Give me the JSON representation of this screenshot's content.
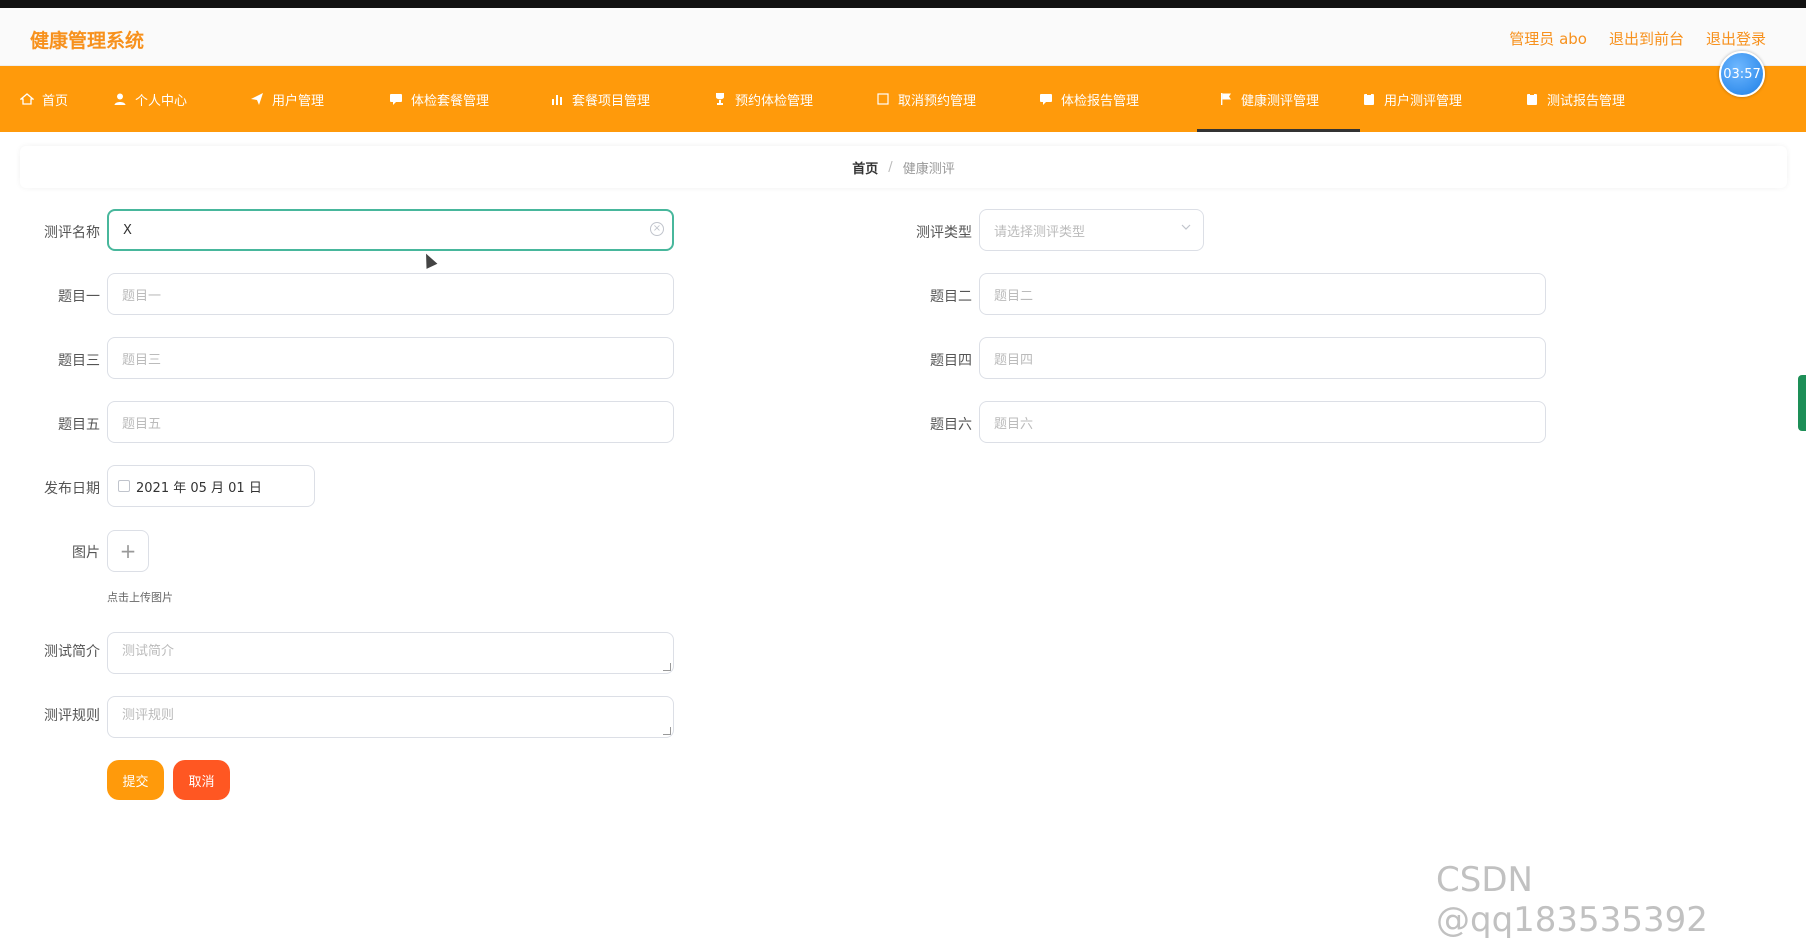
{
  "header": {
    "brand": "健康管理系统",
    "links": [
      "管理员 abo",
      "退出到前台",
      "退出登录"
    ]
  },
  "timer": "03:57",
  "nav": {
    "items": [
      {
        "label": "首页",
        "icon": "home-icon",
        "active": false
      },
      {
        "label": "个人中心",
        "icon": "user-icon",
        "active": false
      },
      {
        "label": "用户管理",
        "icon": "send-icon",
        "active": false
      },
      {
        "label": "体检套餐管理",
        "icon": "chat-icon",
        "active": false
      },
      {
        "label": "套餐项目管理",
        "icon": "bar-chart-icon",
        "active": false
      },
      {
        "label": "预约体检管理",
        "icon": "trophy-icon",
        "active": false
      },
      {
        "label": "取消预约管理",
        "icon": "square-icon",
        "active": false
      },
      {
        "label": "体检报告管理",
        "icon": "chat-icon",
        "active": false
      },
      {
        "label": "健康测评管理",
        "icon": "flag-icon",
        "active": true
      },
      {
        "label": "用户测评管理",
        "icon": "clipboard-icon",
        "active": false
      },
      {
        "label": "测试报告管理",
        "icon": "clipboard-icon",
        "active": false
      }
    ]
  },
  "breadcrumb": {
    "home": "首页",
    "separator": "/",
    "current": "健康测评"
  },
  "form": {
    "name_label": "测评名称",
    "name_value": "X",
    "type_label": "测评类型",
    "type_placeholder": "请选择测评类型",
    "q1_label": "题目一",
    "q1_placeholder": "题目一",
    "q2_label": "题目二",
    "q2_placeholder": "题目二",
    "q3_label": "题目三",
    "q3_placeholder": "题目三",
    "q4_label": "题目四",
    "q4_placeholder": "题目四",
    "q5_label": "题目五",
    "q5_placeholder": "题目五",
    "q6_label": "题目六",
    "q6_placeholder": "题目六",
    "date_label": "发布日期",
    "date_value": "2021 年 05 月 01 日",
    "image_label": "图片",
    "upload_plus": "+",
    "upload_hint": "点击上传图片",
    "intro_label": "测试简介",
    "intro_placeholder": "测试简介",
    "rules_label": "测评规则",
    "rules_placeholder": "测评规则",
    "submit_label": "提交",
    "cancel_label": "取消"
  },
  "watermark": "CSDN @qq183535392",
  "colors": {
    "accent": "#ff9a0b",
    "brand": "#f7911d",
    "focus": "#48b79c",
    "cancel": "#ff5722"
  }
}
